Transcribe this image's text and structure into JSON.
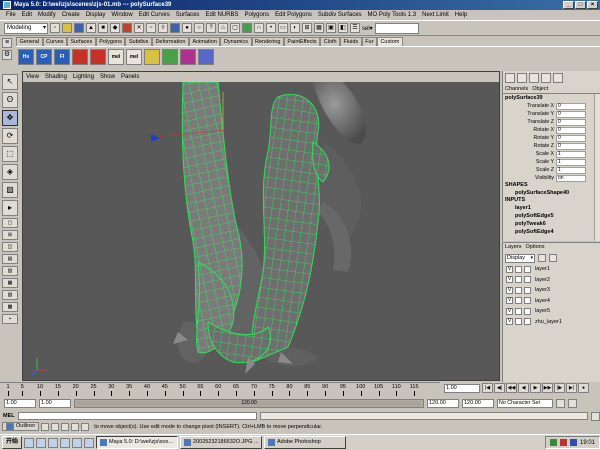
{
  "window": {
    "title": "Maya 5.0: D:\\wei\\zjs\\scenes\\zjs-01.mb  ---  polySurface39"
  },
  "menubar": [
    "File",
    "Edit",
    "Modify",
    "Create",
    "Display",
    "Window",
    "Edit Curves",
    "Surfaces",
    "Edit NURBS",
    "Polygons",
    "Edit Polygons",
    "Subdiv Surfaces",
    "MO Poly Tools 1.3",
    "Next Limit",
    "Help"
  ],
  "statusline": {
    "mode": "Modeling",
    "sel_label": "sel▾"
  },
  "shelf": {
    "tabs": [
      "General",
      "Curves",
      "Surfaces",
      "Polygons",
      "Subdivs",
      "Deformation",
      "Animation",
      "Dynamics",
      "Rendering",
      "PaintEffects",
      "Cloth",
      "Fluids",
      "Fur",
      "Custom"
    ],
    "active_tab": "Custom",
    "icons": [
      "Hs",
      "CP",
      "FI",
      "",
      "",
      "mel",
      "mel",
      "",
      "",
      "",
      ""
    ]
  },
  "viewport": {
    "menu": [
      "View",
      "Shading",
      "Lighting",
      "Show",
      "Panels"
    ]
  },
  "channelbox": {
    "tabs": [
      "Channels",
      "Object"
    ],
    "node": "polySurface39",
    "attributes": [
      {
        "name": "Translate X",
        "value": "0"
      },
      {
        "name": "Translate Y",
        "value": "0"
      },
      {
        "name": "Translate Z",
        "value": "0"
      },
      {
        "name": "Rotate X",
        "value": "0"
      },
      {
        "name": "Rotate Y",
        "value": "0"
      },
      {
        "name": "Rotate Z",
        "value": "0"
      },
      {
        "name": "Scale X",
        "value": "1"
      },
      {
        "name": "Scale Y",
        "value": "1"
      },
      {
        "name": "Scale Z",
        "value": "1"
      },
      {
        "name": "Visibility",
        "value": "on"
      }
    ],
    "shapes_label": "SHAPES",
    "shapes": [
      "polySurfaceShape40"
    ],
    "inputs_label": "INPUTS",
    "inputs": [
      "layer1",
      "polySoftEdge5",
      "polyTweak6",
      "polySoftEdge4"
    ]
  },
  "layers": {
    "tabs": [
      "Layers",
      "Options"
    ],
    "display": "Display",
    "items": [
      {
        "vis": "V",
        "name": "layer1"
      },
      {
        "vis": "V",
        "name": "layer2"
      },
      {
        "vis": "V",
        "name": "layer3"
      },
      {
        "vis": "V",
        "name": "layer4"
      },
      {
        "vis": "V",
        "name": "layer5"
      },
      {
        "vis": "V",
        "name": "zhu_layer1"
      }
    ]
  },
  "timeslider": {
    "ticks": [
      "1",
      "5",
      "10",
      "15",
      "20",
      "25",
      "30",
      "35",
      "40",
      "45",
      "50",
      "55",
      "60",
      "65",
      "70",
      "75",
      "80",
      "85",
      "90",
      "95",
      "100",
      "105",
      "110",
      "115"
    ],
    "current": "1.00"
  },
  "rangeslider": {
    "start": "1.00",
    "playback_start": "1.00",
    "range_label": "120.00",
    "playback_end": "120.00",
    "end": "120.00",
    "character_set": "No Character Set"
  },
  "cmdline": {
    "label": "MEL"
  },
  "helpline": {
    "outliner": "Outliner",
    "text": "to move object(s). Use edit mode to change pivot (INSERT). Ctrl+LMB to move perpendicular."
  },
  "taskbar": {
    "start": "开始",
    "tasks": [
      "Maya 5.0: D:\\wei\\zjs\\sce...",
      "20025232186632O.JPG ...",
      "Adobe Photoshop"
    ],
    "active_task": 0,
    "clock": "19:01"
  }
}
